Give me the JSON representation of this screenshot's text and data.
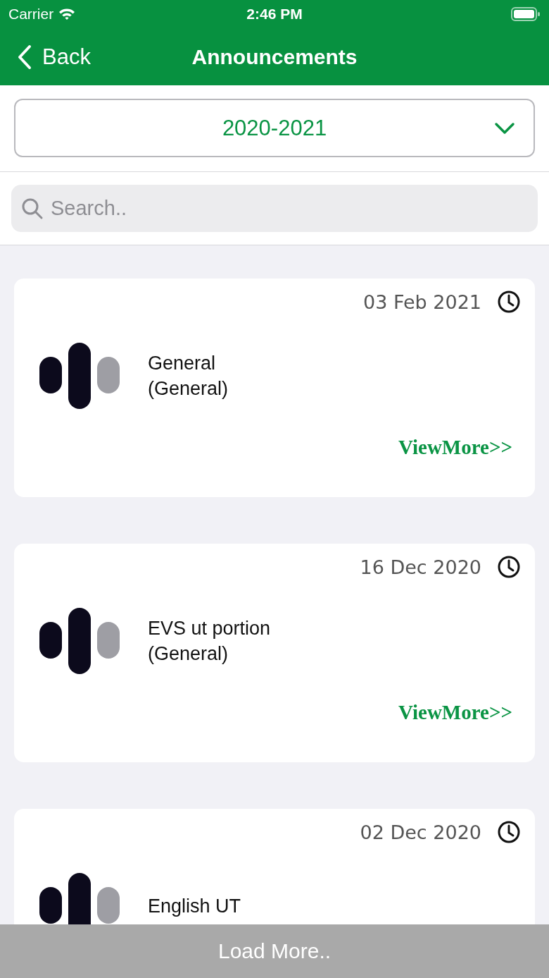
{
  "status_bar": {
    "carrier": "Carrier",
    "time": "2:46 PM"
  },
  "nav": {
    "back": "Back",
    "title": "Announcements"
  },
  "year_picker": {
    "value": "2020-2021"
  },
  "search": {
    "placeholder": "Search.."
  },
  "announcements": [
    {
      "date": "03 Feb 2021",
      "title": "General",
      "category": "(General)",
      "link": "ViewMore>>"
    },
    {
      "date": "16 Dec 2020",
      "title": "EVS ut portion",
      "category": "(General)",
      "link": "ViewMore>>"
    },
    {
      "date": "02 Dec 2020",
      "title": "English UT"
    }
  ],
  "load_more": "Load More.."
}
